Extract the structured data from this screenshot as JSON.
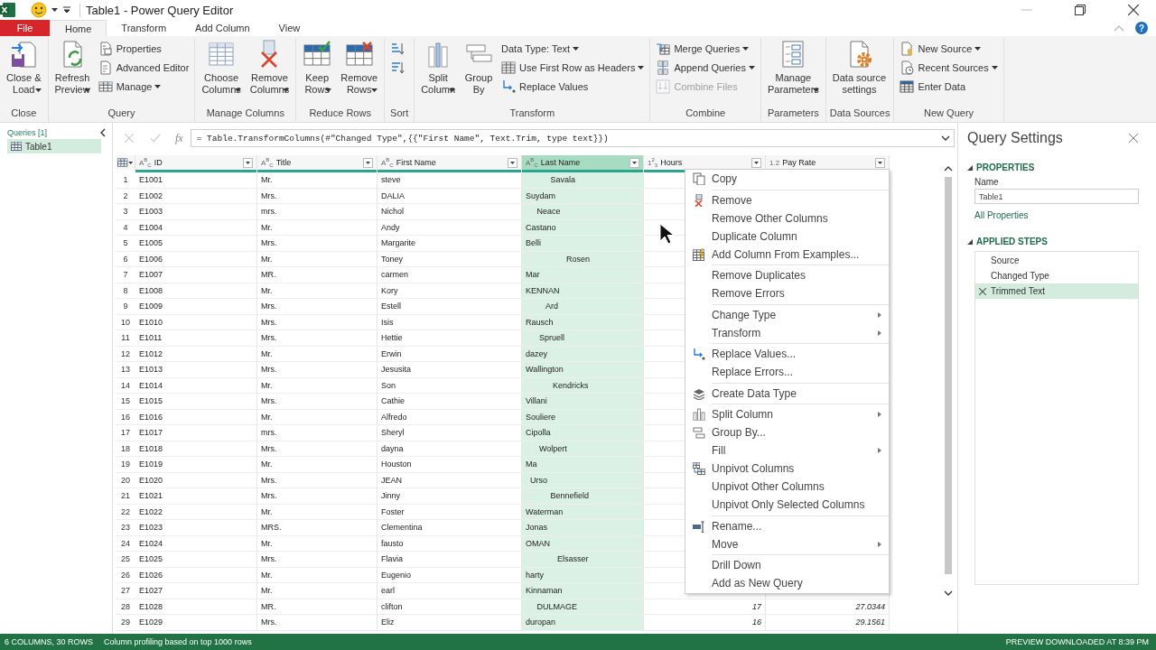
{
  "window": {
    "title": "Table1 - Power Query Editor"
  },
  "tabs": [
    {
      "label": "File",
      "kind": "file",
      "selected": false
    },
    {
      "label": "Home",
      "kind": "tab",
      "selected": true
    },
    {
      "label": "Transform",
      "kind": "tab",
      "selected": false
    },
    {
      "label": "Add Column",
      "kind": "tab",
      "selected": false
    },
    {
      "label": "View",
      "kind": "tab",
      "selected": false
    }
  ],
  "help": "?",
  "ribbon": {
    "groups": [
      {
        "label": "Close",
        "items": [
          {
            "kind": "large",
            "lines": [
              "Close &",
              "Load"
            ],
            "dropdown": true,
            "disabled": false
          }
        ]
      },
      {
        "label": "Query",
        "items": [
          {
            "kind": "large",
            "lines": [
              "Refresh",
              "Preview"
            ],
            "dropdown": true,
            "disabled": false
          },
          {
            "kind": "stack",
            "items": [
              {
                "label": "Properties",
                "dropdown": false,
                "disabled": false
              },
              {
                "label": "Advanced Editor",
                "dropdown": false,
                "disabled": false
              },
              {
                "label": "Manage",
                "dropdown": true,
                "disabled": false
              }
            ]
          }
        ]
      },
      {
        "label": "Manage Columns",
        "items": [
          {
            "kind": "large",
            "lines": [
              "Choose",
              "Columns"
            ],
            "dropdown": true,
            "disabled": false
          },
          {
            "kind": "large",
            "lines": [
              "Remove",
              "Columns"
            ],
            "dropdown": true,
            "disabled": false
          }
        ]
      },
      {
        "label": "Reduce Rows",
        "items": [
          {
            "kind": "large",
            "lines": [
              "Keep",
              "Rows"
            ],
            "dropdown": true,
            "disabled": false
          },
          {
            "kind": "large",
            "lines": [
              "Remove",
              "Rows"
            ],
            "dropdown": true,
            "disabled": false
          }
        ]
      },
      {
        "label": "Sort",
        "items": [
          {
            "kind": "stack",
            "items": [
              {
                "dropdown": false,
                "disabled": false
              },
              {
                "dropdown": false,
                "disabled": false
              }
            ]
          }
        ]
      },
      {
        "label": "Transform",
        "items": [
          {
            "kind": "large",
            "lines": [
              "Split",
              "Column"
            ],
            "dropdown": true,
            "disabled": false
          },
          {
            "kind": "large",
            "lines": [
              "Group",
              "By"
            ],
            "dropdown": false,
            "disabled": false
          },
          {
            "kind": "stack",
            "items": [
              {
                "label": "Data Type: Text",
                "dropdown": true,
                "disabled": false
              },
              {
                "label": "Use First Row as Headers",
                "dropdown": true,
                "disabled": false
              },
              {
                "label": "Replace Values",
                "dropdown": false,
                "disabled": false
              }
            ]
          }
        ]
      },
      {
        "label": "Combine",
        "items": [
          {
            "kind": "stack",
            "items": [
              {
                "label": "Merge Queries",
                "dropdown": true,
                "disabled": false
              },
              {
                "label": "Append Queries",
                "dropdown": true,
                "disabled": false
              },
              {
                "label": "Combine Files",
                "dropdown": false,
                "disabled": true
              }
            ]
          }
        ]
      },
      {
        "label": "Parameters",
        "items": [
          {
            "kind": "large",
            "lines": [
              "Manage",
              "Parameters"
            ],
            "dropdown": true,
            "disabled": false
          }
        ]
      },
      {
        "label": "Data Sources",
        "items": [
          {
            "kind": "large",
            "lines": [
              "Data source",
              "settings"
            ],
            "dropdown": false,
            "disabled": false
          }
        ]
      },
      {
        "label": "New Query",
        "items": [
          {
            "kind": "stack",
            "items": [
              {
                "label": "New Source",
                "dropdown": true,
                "disabled": false
              },
              {
                "label": "Recent Sources",
                "dropdown": true,
                "disabled": false
              },
              {
                "label": "Enter Data",
                "dropdown": false,
                "disabled": false
              }
            ]
          }
        ]
      }
    ]
  },
  "queries_pane": {
    "title": "Queries [1]",
    "items": [
      {
        "label": "Table1",
        "selected": true
      }
    ]
  },
  "formula_bar": {
    "fx": "fx",
    "formula": "= Table.TransformColumns(#\"Changed Type\",{{\"First Name\", Text.Trim, type text}})"
  },
  "table": {
    "columns": [
      {
        "type": "A$^{B}$$_{C}$",
        "name": "ID",
        "kind": "text",
        "selected": false
      },
      {
        "type": "A$^{B}$$_{C}$",
        "name": "Title",
        "kind": "text",
        "selected": false
      },
      {
        "type": "A$^{B}$$_{C}$",
        "name": "First Name",
        "kind": "text",
        "selected": false
      },
      {
        "type": "A$^{B}$$_{C}$",
        "name": "Last Name",
        "kind": "text",
        "selected": true
      },
      {
        "type": "1$^{2}$$_{3}$",
        "name": "Hours",
        "kind": "number",
        "selected": false
      },
      {
        "type": "1.2",
        "name": "Pay Rate",
        "kind": "number",
        "selected": false
      }
    ],
    "rows": [
      {
        "number": "1",
        "cells": [
          "E1001",
          "Mr.",
          "steve",
          "           Savala"
        ]
      },
      {
        "number": "2",
        "cells": [
          "E1002",
          "Mrs.",
          "DALIA",
          "Suydam"
        ]
      },
      {
        "number": "3",
        "cells": [
          "E1003",
          "mrs.",
          "Nichol",
          "     Neace"
        ]
      },
      {
        "number": "4",
        "cells": [
          "E1004",
          "Mr.",
          "Andy",
          "Castano"
        ]
      },
      {
        "number": "5",
        "cells": [
          "E1005",
          "Mrs.",
          "Margarite",
          "Belli"
        ]
      },
      {
        "number": "6",
        "cells": [
          "E1006",
          "Mr.",
          "Toney",
          "                  Rosen"
        ]
      },
      {
        "number": "7",
        "cells": [
          "E1007",
          "MR.",
          "carmen",
          "Mar"
        ]
      },
      {
        "number": "8",
        "cells": [
          "E1008",
          "Mr.",
          "Kory",
          "KENNAN"
        ]
      },
      {
        "number": "9",
        "cells": [
          "E1009",
          "Mrs.",
          "Estell",
          "         Ard"
        ]
      },
      {
        "number": "10",
        "cells": [
          "E1010",
          "Mrs.",
          "Isis",
          "Rausch"
        ]
      },
      {
        "number": "11",
        "cells": [
          "E1011",
          "Mrs.",
          "Hettie",
          "      Spruell"
        ]
      },
      {
        "number": "12",
        "cells": [
          "E1012",
          "Mr.",
          "Erwin",
          "dazey"
        ]
      },
      {
        "number": "13",
        "cells": [
          "E1013",
          "Mrs.",
          "Jesusita",
          "Wallington"
        ]
      },
      {
        "number": "14",
        "cells": [
          "E1014",
          "Mr.",
          "Son",
          "            Kendricks"
        ]
      },
      {
        "number": "15",
        "cells": [
          "E1015",
          "Mrs.",
          "Cathie",
          "Villani"
        ]
      },
      {
        "number": "16",
        "cells": [
          "E1016",
          "Mr.",
          "Alfredo",
          "Souliere"
        ]
      },
      {
        "number": "17",
        "cells": [
          "E1017",
          "mrs.",
          "Sheryl",
          "Cipolla"
        ]
      },
      {
        "number": "18",
        "cells": [
          "E1018",
          "Mrs.",
          "dayna",
          "      Wolpert"
        ]
      },
      {
        "number": "19",
        "cells": [
          "E1019",
          "Mr.",
          "Houston",
          "Ma"
        ]
      },
      {
        "number": "20",
        "cells": [
          "E1020",
          "Mrs.",
          "JEAN",
          "  Urso"
        ]
      },
      {
        "number": "21",
        "cells": [
          "E1021",
          "Mrs.",
          "Jinny",
          "           Bennefield"
        ]
      },
      {
        "number": "22",
        "cells": [
          "E1022",
          "Mr.",
          "Foster",
          "Waterman"
        ]
      },
      {
        "number": "23",
        "cells": [
          "E1023",
          "MRS.",
          "Clementina",
          "Jonas"
        ]
      },
      {
        "number": "24",
        "cells": [
          "E1024",
          "Mr.",
          "fausto",
          "OMAN"
        ]
      },
      {
        "number": "25",
        "cells": [
          "E1025",
          "Mrs.",
          "Flavia",
          "              Elsasser"
        ]
      },
      {
        "number": "26",
        "cells": [
          "E1026",
          "Mr.",
          "Eugenio",
          "harty"
        ]
      },
      {
        "number": "27",
        "cells": [
          "E1027",
          "Mr.",
          "earl",
          "Kinnaman"
        ]
      },
      {
        "number": "28",
        "cells": [
          "E1028",
          "MR.",
          "clifton",
          "     DULMAGE",
          "17",
          "27.0344"
        ]
      },
      {
        "number": "29",
        "cells": [
          "E1029",
          "Mrs.",
          "Eliz",
          "duropan",
          "16",
          "29.1561"
        ]
      }
    ]
  },
  "context_menu": {
    "groups": [
      [
        {
          "label": "Copy",
          "submenu": false
        }
      ],
      [
        {
          "label": "Remove",
          "submenu": false
        },
        {
          "label": "Remove Other Columns",
          "submenu": false
        },
        {
          "label": "Duplicate Column",
          "submenu": false
        },
        {
          "label": "Add Column From Examples...",
          "submenu": false
        }
      ],
      [
        {
          "label": "Remove Duplicates",
          "submenu": false
        },
        {
          "label": "Remove Errors",
          "submenu": false
        }
      ],
      [
        {
          "label": "Change Type",
          "submenu": true
        },
        {
          "label": "Transform",
          "submenu": true
        }
      ],
      [
        {
          "label": "Replace Values...",
          "submenu": false
        },
        {
          "label": "Replace Errors...",
          "submenu": false
        }
      ],
      [
        {
          "label": "Create Data Type",
          "submenu": false
        }
      ],
      [
        {
          "label": "Split Column",
          "submenu": true
        },
        {
          "label": "Group By...",
          "submenu": false
        },
        {
          "label": "Fill",
          "submenu": true
        },
        {
          "label": "Unpivot Columns",
          "submenu": false
        },
        {
          "label": "Unpivot Other Columns",
          "submenu": false
        },
        {
          "label": "Unpivot Only Selected Columns",
          "submenu": false
        }
      ],
      [
        {
          "label": "Rename...",
          "submenu": false
        },
        {
          "label": "Move",
          "submenu": true
        }
      ],
      [
        {
          "label": "Drill Down",
          "submenu": false
        },
        {
          "label": "Add as New Query",
          "submenu": false
        }
      ]
    ]
  },
  "query_settings": {
    "title": "Query Settings",
    "properties": {
      "heading": "PROPERTIES",
      "name_label": "Name",
      "name_value": "Table1",
      "link": "All Properties"
    },
    "applied_steps": {
      "heading": "APPLIED STEPS",
      "steps": [
        {
          "label": "Source",
          "selected": false
        },
        {
          "label": "Changed Type",
          "selected": false
        },
        {
          "label": "Trimmed Text",
          "selected": true
        }
      ]
    }
  },
  "status_bar": {
    "left": [
      "6 COLUMNS, 30 ROWS",
      "Column profiling based on top 1000 rows"
    ],
    "right": "PREVIEW DOWNLOADED AT 8:39 PM"
  }
}
